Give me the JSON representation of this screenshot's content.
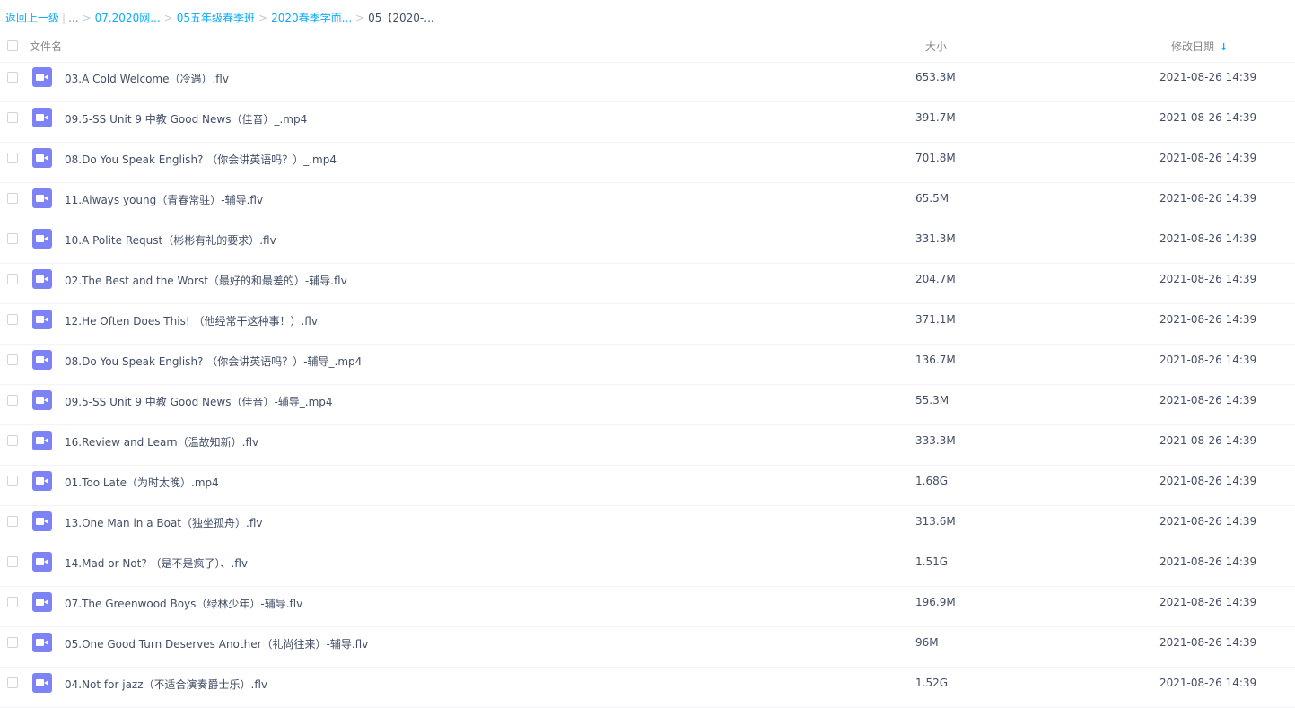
{
  "breadcrumb": {
    "back": "返回上一级",
    "ellipsis": "...",
    "items": [
      "07.2020网...",
      "05五年级春季班",
      "2020春季学而..."
    ],
    "current": "05【2020-..."
  },
  "header": {
    "name": "文件名",
    "size": "大小",
    "date": "修改日期",
    "sort_icon": "arrow-down-icon"
  },
  "colors": {
    "accent": "#09aaff",
    "video_icon": "#7d83f5",
    "text": "#424e67"
  },
  "files": [
    {
      "name": "03.A Cold Welcome（冷遇）.flv",
      "size": "653.3M",
      "date": "2021-08-26 14:39",
      "icon": "video-file-icon"
    },
    {
      "name": "09.5-SS Unit 9 中教 Good News（佳音）_.mp4",
      "size": "391.7M",
      "date": "2021-08-26 14:39",
      "icon": "video-file-icon"
    },
    {
      "name": "08.Do You Speak English? （你会讲英语吗？）_.mp4",
      "size": "701.8M",
      "date": "2021-08-26 14:39",
      "icon": "video-file-icon"
    },
    {
      "name": "11.Always young（青春常驻）-辅导.flv",
      "size": "65.5M",
      "date": "2021-08-26 14:39",
      "icon": "video-file-icon"
    },
    {
      "name": "10.A Polite Requst（彬彬有礼的要求）.flv",
      "size": "331.3M",
      "date": "2021-08-26 14:39",
      "icon": "video-file-icon"
    },
    {
      "name": "02.The Best and the Worst（最好的和最差的）-辅导.flv",
      "size": "204.7M",
      "date": "2021-08-26 14:39",
      "icon": "video-file-icon"
    },
    {
      "name": "12.He Often Does This! （他经常干这种事！）.flv",
      "size": "371.1M",
      "date": "2021-08-26 14:39",
      "icon": "video-file-icon"
    },
    {
      "name": "08.Do You Speak English? （你会讲英语吗？）-辅导_.mp4",
      "size": "136.7M",
      "date": "2021-08-26 14:39",
      "icon": "video-file-icon"
    },
    {
      "name": "09.5-SS Unit 9 中教 Good News（佳音）-辅导_.mp4",
      "size": "55.3M",
      "date": "2021-08-26 14:39",
      "icon": "video-file-icon"
    },
    {
      "name": "16.Review and Learn（温故知新）.flv",
      "size": "333.3M",
      "date": "2021-08-26 14:39",
      "icon": "video-file-icon"
    },
    {
      "name": "01.Too Late（为时太晚）.mp4",
      "size": "1.68G",
      "date": "2021-08-26 14:39",
      "icon": "video-file-icon"
    },
    {
      "name": "13.One Man in a Boat（独坐孤舟）.flv",
      "size": "313.6M",
      "date": "2021-08-26 14:39",
      "icon": "video-file-icon"
    },
    {
      "name": "14.Mad or Not? （是不是疯了）、.flv",
      "size": "1.51G",
      "date": "2021-08-26 14:39",
      "icon": "video-file-icon"
    },
    {
      "name": "07.The Greenwood Boys（绿林少年）-辅导.flv",
      "size": "196.9M",
      "date": "2021-08-26 14:39",
      "icon": "video-file-icon"
    },
    {
      "name": "05.One Good Turn Deserves Another（礼尚往来）-辅导.flv",
      "size": "96M",
      "date": "2021-08-26 14:39",
      "icon": "video-file-icon"
    },
    {
      "name": "04.Not for jazz（不适合演奏爵士乐）.flv",
      "size": "1.52G",
      "date": "2021-08-26 14:39",
      "icon": "video-file-icon"
    }
  ]
}
